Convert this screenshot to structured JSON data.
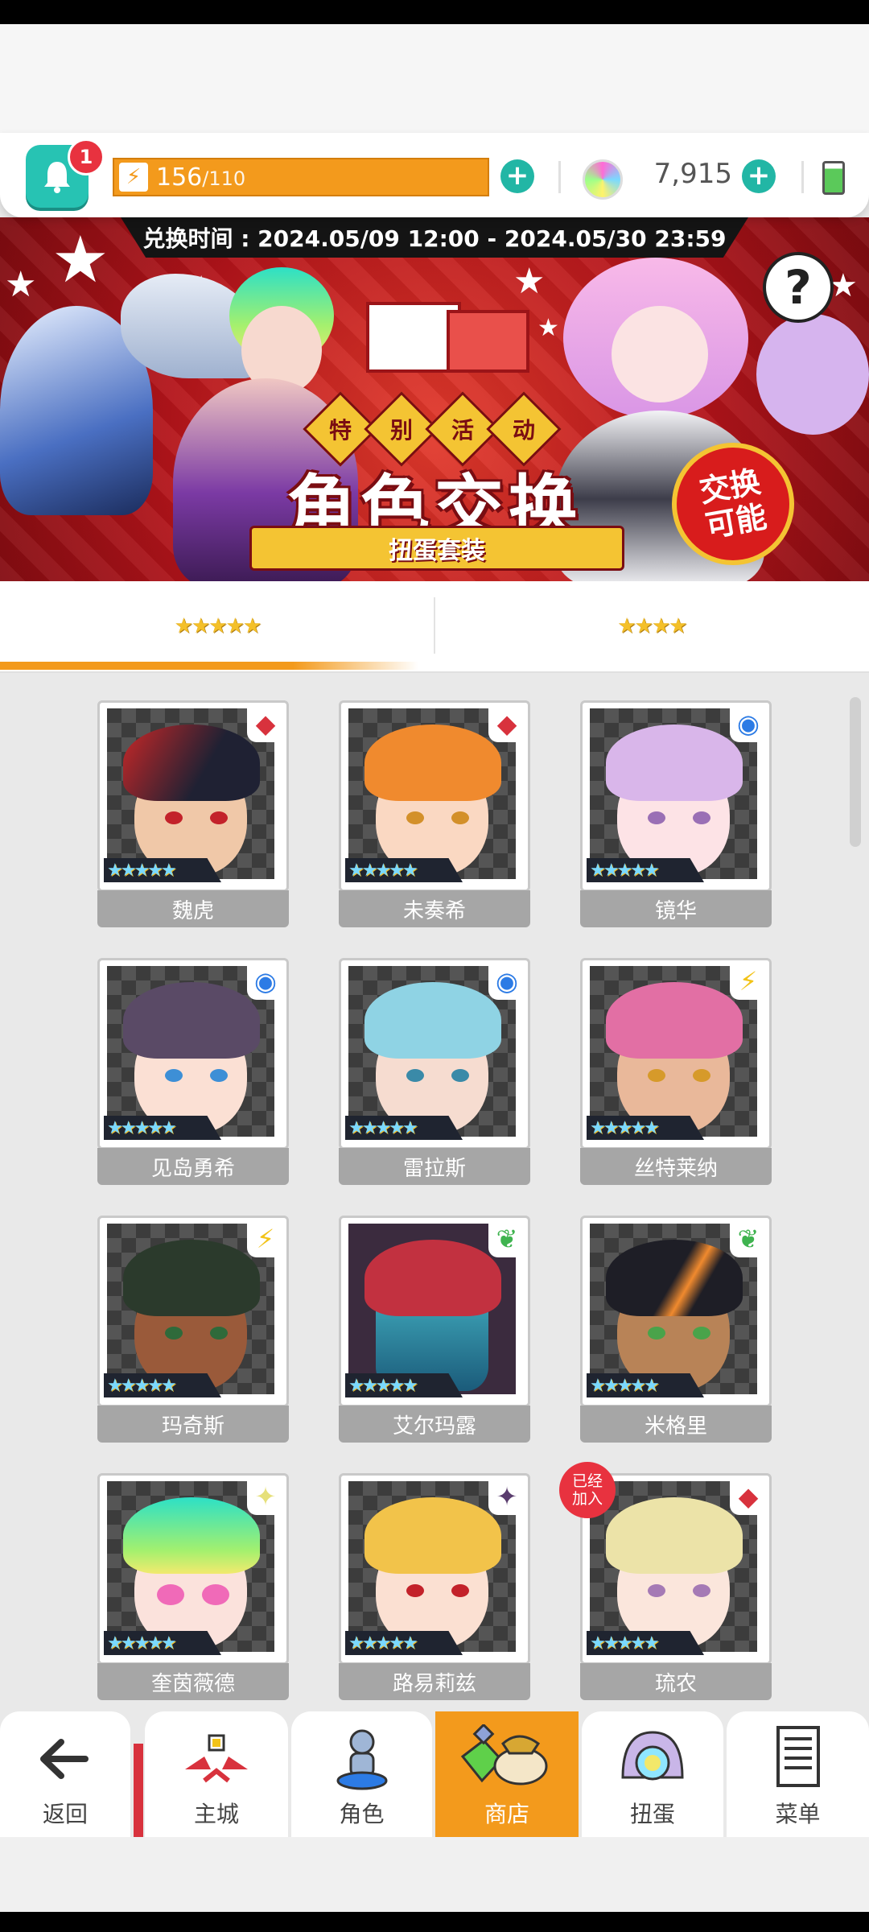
{
  "header": {
    "notifications_count": "1",
    "energy_current": "156",
    "energy_max": "/110",
    "gems": "7,915",
    "battery_level_percent": 82
  },
  "banner": {
    "exchange_period": "兑换时间 : 2024.05/09 12:00 - 2024.05/30 23:59",
    "event_tags": [
      "特",
      "别",
      "活",
      "动"
    ],
    "title": "角色交换",
    "subtitle": "扭蛋套装",
    "badge": "交换可能"
  },
  "tabs": [
    {
      "label": "★★★★★",
      "stars": 5,
      "selected": true
    },
    {
      "label": "★★★★",
      "stars": 4,
      "selected": false
    }
  ],
  "characters": [
    {
      "name": "魏虎",
      "rarity": "★★★★★",
      "element_icon": "diamond-icon",
      "element_color": "#d8323d"
    },
    {
      "name": "未奏希",
      "rarity": "★★★★★",
      "element_icon": "diamond-icon",
      "element_color": "#d8323d"
    },
    {
      "name": "镜华",
      "rarity": "★★★★★",
      "element_icon": "water-icon",
      "element_color": "#2c7be5"
    },
    {
      "name": "见岛勇希",
      "rarity": "★★★★★",
      "element_icon": "water-icon",
      "element_color": "#2c7be5"
    },
    {
      "name": "雷拉斯",
      "rarity": "★★★★★",
      "element_icon": "water-icon",
      "element_color": "#2c7be5"
    },
    {
      "name": "丝特莱纳",
      "rarity": "★★★★★",
      "element_icon": "lightning-icon",
      "element_color": "#f2c318"
    },
    {
      "name": "玛奇斯",
      "rarity": "★★★★★",
      "element_icon": "lightning-icon",
      "element_color": "#f2c318"
    },
    {
      "name": "艾尔玛露",
      "rarity": "★★★★★",
      "element_icon": "leaf-icon",
      "element_color": "#3fb34f"
    },
    {
      "name": "米格里",
      "rarity": "★★★★★",
      "element_icon": "leaf-icon",
      "element_color": "#3fb34f"
    },
    {
      "name": "奎茵薇德",
      "rarity": "★★★★★",
      "element_icon": "light-icon",
      "element_color": "#e6e07a"
    },
    {
      "name": "路易莉兹",
      "rarity": "★★★★★",
      "element_icon": "dark-icon",
      "element_color": "#5a3d6e"
    },
    {
      "name": "琉农",
      "rarity": "★★★★★",
      "element_icon": "diamond-icon",
      "element_color": "#d8323d",
      "joined_badge": "已经加入"
    }
  ],
  "bottom_nav": [
    {
      "label": "返回",
      "icon": "back-arrow-icon"
    },
    {
      "label": "主城",
      "icon": "castle-icon"
    },
    {
      "label": "角色",
      "icon": "character-icon"
    },
    {
      "label": "商店",
      "icon": "shop-icon",
      "active": true
    },
    {
      "label": "扭蛋",
      "icon": "gacha-icon"
    },
    {
      "label": "菜单",
      "icon": "menu-icon"
    }
  ],
  "colors": {
    "accent": "#f39a1c",
    "teal": "#27c3b3",
    "banner_red": "#b3141a"
  }
}
